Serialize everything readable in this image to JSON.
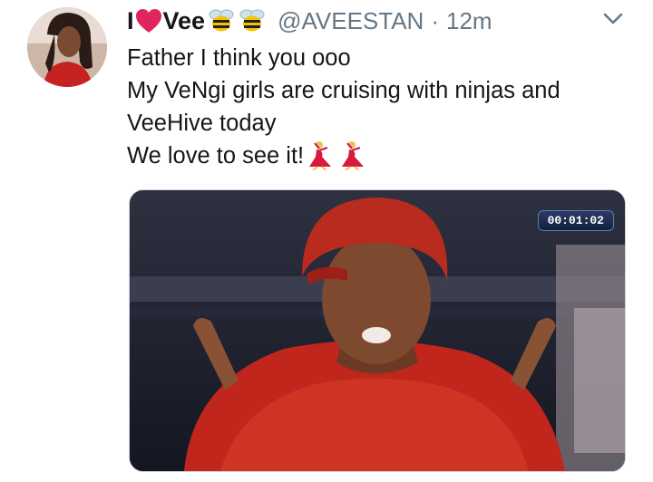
{
  "tweet": {
    "author": {
      "name_prefix": "I",
      "heart_icon": "red-heart-icon",
      "name_suffix": "Vee",
      "badge_icons": [
        "bee-icon",
        "bee-icon"
      ],
      "handle": "@AVEESTAN",
      "separator": "·",
      "time": "12m"
    },
    "menu_icon": "chevron-down-icon",
    "text_lines": [
      "Father I think you ooo",
      "My VeNgi girls are cruising with ninjas and",
      "VeeHive today",
      "We love to see it!"
    ],
    "text_emojis": [
      "dancer-icon",
      "dancer-icon"
    ],
    "media": {
      "timer": "00:01:02"
    }
  },
  "colors": {
    "text": "#14171a",
    "secondary": "#657786",
    "heart": "#e0245e",
    "media_border": "#ccd6dd"
  }
}
